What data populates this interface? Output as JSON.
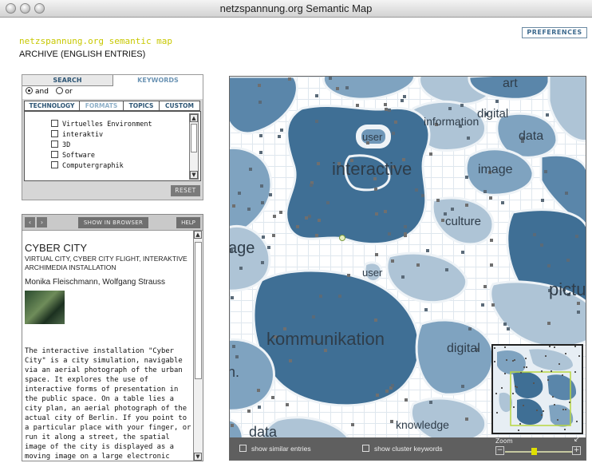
{
  "window": {
    "title": "netzspannung.org Semantic Map"
  },
  "header": {
    "preferences": "PREFERENCES",
    "app_name": "netzspannung.org semantic map",
    "archive": "ARCHIVE (ENGLISH ENTRIES)"
  },
  "search": {
    "tab_search": "SEARCH",
    "tab_keywords": "KEYWORDS",
    "and_label": "and",
    "or_label": "or",
    "subtabs": [
      "TECHNOLOGY",
      "FORMATS",
      "TOPICS",
      "CUSTOM"
    ],
    "keywords": [
      "Virtuelles Environment",
      "interaktiv",
      "3D",
      "Software",
      "Computergraphik"
    ],
    "reset": "RESET"
  },
  "detail": {
    "show_in_browser": "SHOW IN BROWSER",
    "help": "HELP",
    "title": "CYBER CITY",
    "subtitle": "VIRTUAL CITY, CYBER CITY FLIGHT, INTERAKTIVE ARCHIMEDIA INSTALLATION",
    "authors": "Monika Fleischmann, Wolfgang Strauss",
    "text": "The interactive installation \"Cyber City\" is a city simulation, navigable via an aerial photograph of the urban space. It explores the use of interactive forms of presentation in the public space. On a table lies a city plan, an aerial photograph of the actual city of Berlin. If you point to a particular place with your finger, or run it along a street, the spatial image of the city is displayed as a moving image on a large electronic"
  },
  "map": {
    "labels": {
      "art": "art",
      "information": "information",
      "digital_top": "digital",
      "user_top": "user",
      "data_top": "data",
      "interactive": "interactive",
      "image": "image",
      "culture": "culture",
      "age": "age",
      "user_mid": "user",
      "pictu": "pictu",
      "kommunikation": "kommunikation",
      "digital_bottom": "digital",
      "n": "n.",
      "knowledge": "knowledge",
      "data_bottom": "data"
    },
    "bottom_bar": {
      "similar": "show similar entries",
      "cluster": "show cluster keywords",
      "zoom": "Zoom"
    },
    "colors": {
      "dark": "#3f6f95",
      "medium": "#7fa3c0",
      "light": "#aec4d6",
      "border": "#eef3f7"
    }
  }
}
